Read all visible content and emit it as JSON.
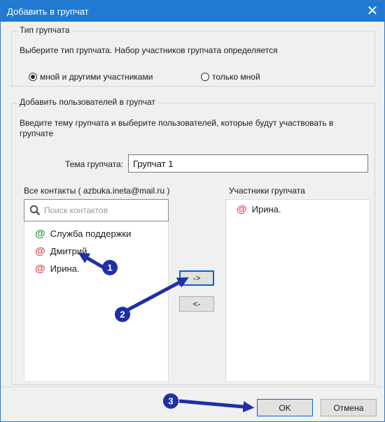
{
  "window": {
    "title": "Добавить в групчат",
    "close_glyph": "✕"
  },
  "type_group": {
    "legend": "Тип групчата",
    "description": "Выберите тип групчата. Набор участников групчата определяется",
    "options": [
      {
        "label": "мной и другими участниками",
        "selected": true
      },
      {
        "label": "только мной",
        "selected": false
      }
    ]
  },
  "add_group": {
    "legend": "Добавить пользователей в групчат",
    "description_line1": "Введите тему групчата и выберите пользователей, которые будут участвовать в",
    "description_line2": "групчате",
    "topic_label": "Тема групчата:",
    "topic_value": "Групчат 1",
    "contacts_header": "Все контакты ( azbuka.ineta@mail.ru )",
    "search_placeholder": "Поиск контактов",
    "contacts": [
      {
        "name": "Служба поддержки",
        "icon": "at-icon",
        "color": "#1f9b3a"
      },
      {
        "name": "Дмитрий",
        "icon": "at-icon",
        "color": "#e4474d"
      },
      {
        "name": "Ирина.",
        "icon": "at-icon",
        "color": "#e4474d"
      }
    ],
    "participants_header": "Участники групчата",
    "participants": [
      {
        "name": "Ирина.",
        "icon": "at-icon",
        "color": "#e4474d"
      }
    ],
    "add_arrow": "->",
    "remove_arrow": "<-"
  },
  "footer": {
    "ok_label": "OK",
    "cancel_label": "Отмена"
  },
  "annotations": {
    "color": "#1f2fa6",
    "markers": [
      "1",
      "2",
      "3"
    ]
  },
  "colors": {
    "titlebar": "#1f7ad3",
    "window_bg": "#f0f0f0",
    "focus_border": "#0a64c8"
  }
}
